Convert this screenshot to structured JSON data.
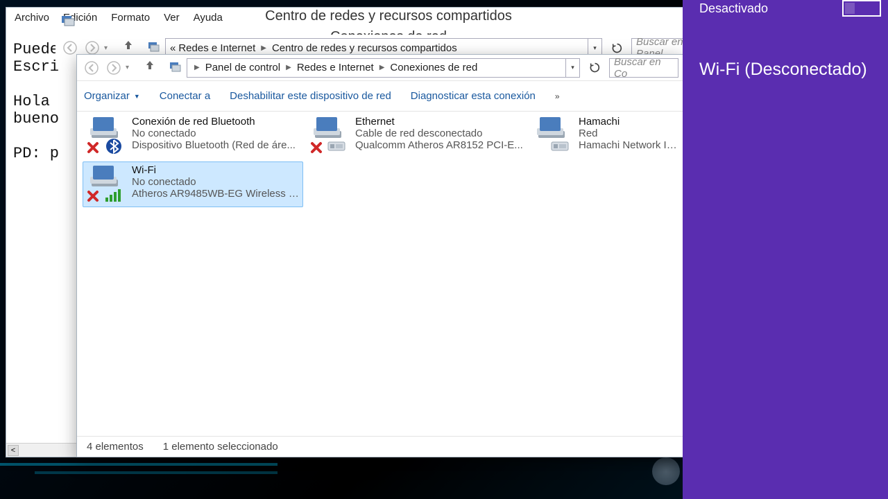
{
  "notepad": {
    "menu": {
      "file": "Archivo",
      "edit": "Edición",
      "format": "Formato",
      "view": "Ver",
      "help": "Ayuda"
    },
    "lines": [
      "Puede",
      "Escri",
      "",
      "Hola",
      "bueno",
      "",
      "PD: p"
    ]
  },
  "win_bg": {
    "title": "Centro de redes y recursos compartidos",
    "subtitle": "Conexiones de red",
    "addr": {
      "prefix": "«",
      "crumbs": [
        "Redes e Internet",
        "Centro de redes y recursos compartidos"
      ]
    },
    "search_placeholder": "Buscar en el Panel"
  },
  "win_main": {
    "addr": {
      "crumbs": [
        "Panel de control",
        "Redes e Internet",
        "Conexiones de red"
      ]
    },
    "search_placeholder": "Buscar en Co",
    "toolbar": {
      "organize": "Organizar",
      "connect": "Conectar a",
      "disable": "Deshabilitar este dispositivo de red",
      "diagnose": "Diagnosticar esta conexión",
      "more": "»"
    },
    "adapters": [
      {
        "name": "Conexión de red Bluetooth",
        "status": "No conectado",
        "device": "Dispositivo Bluetooth (Red de áre...",
        "selected": false,
        "statusIcon": "x",
        "subIcon": "bluetooth"
      },
      {
        "name": "Ethernet",
        "status": "Cable de red desconectado",
        "device": "Qualcomm Atheros AR8152 PCI-E...",
        "selected": false,
        "statusIcon": "x",
        "subIcon": "nic"
      },
      {
        "name": "Hamachi",
        "status": "Red",
        "device": "Hamachi Network Int...",
        "selected": false,
        "statusIcon": "none",
        "subIcon": "nic"
      },
      {
        "name": "Wi-Fi",
        "status": "No conectado",
        "device": "Atheros AR9485WB-EG Wireless N...",
        "selected": true,
        "statusIcon": "x",
        "subIcon": "wifi"
      }
    ],
    "statusbar": {
      "count": "4 elementos",
      "selection": "1 elemento seleccionado"
    }
  },
  "charms": {
    "mode_label": "Desactivado",
    "wifi_title": "Wi-Fi (Desconectado)"
  },
  "colors": {
    "charms_bg": "#5a2db0",
    "link": "#19589e",
    "x_red": "#d02828"
  }
}
